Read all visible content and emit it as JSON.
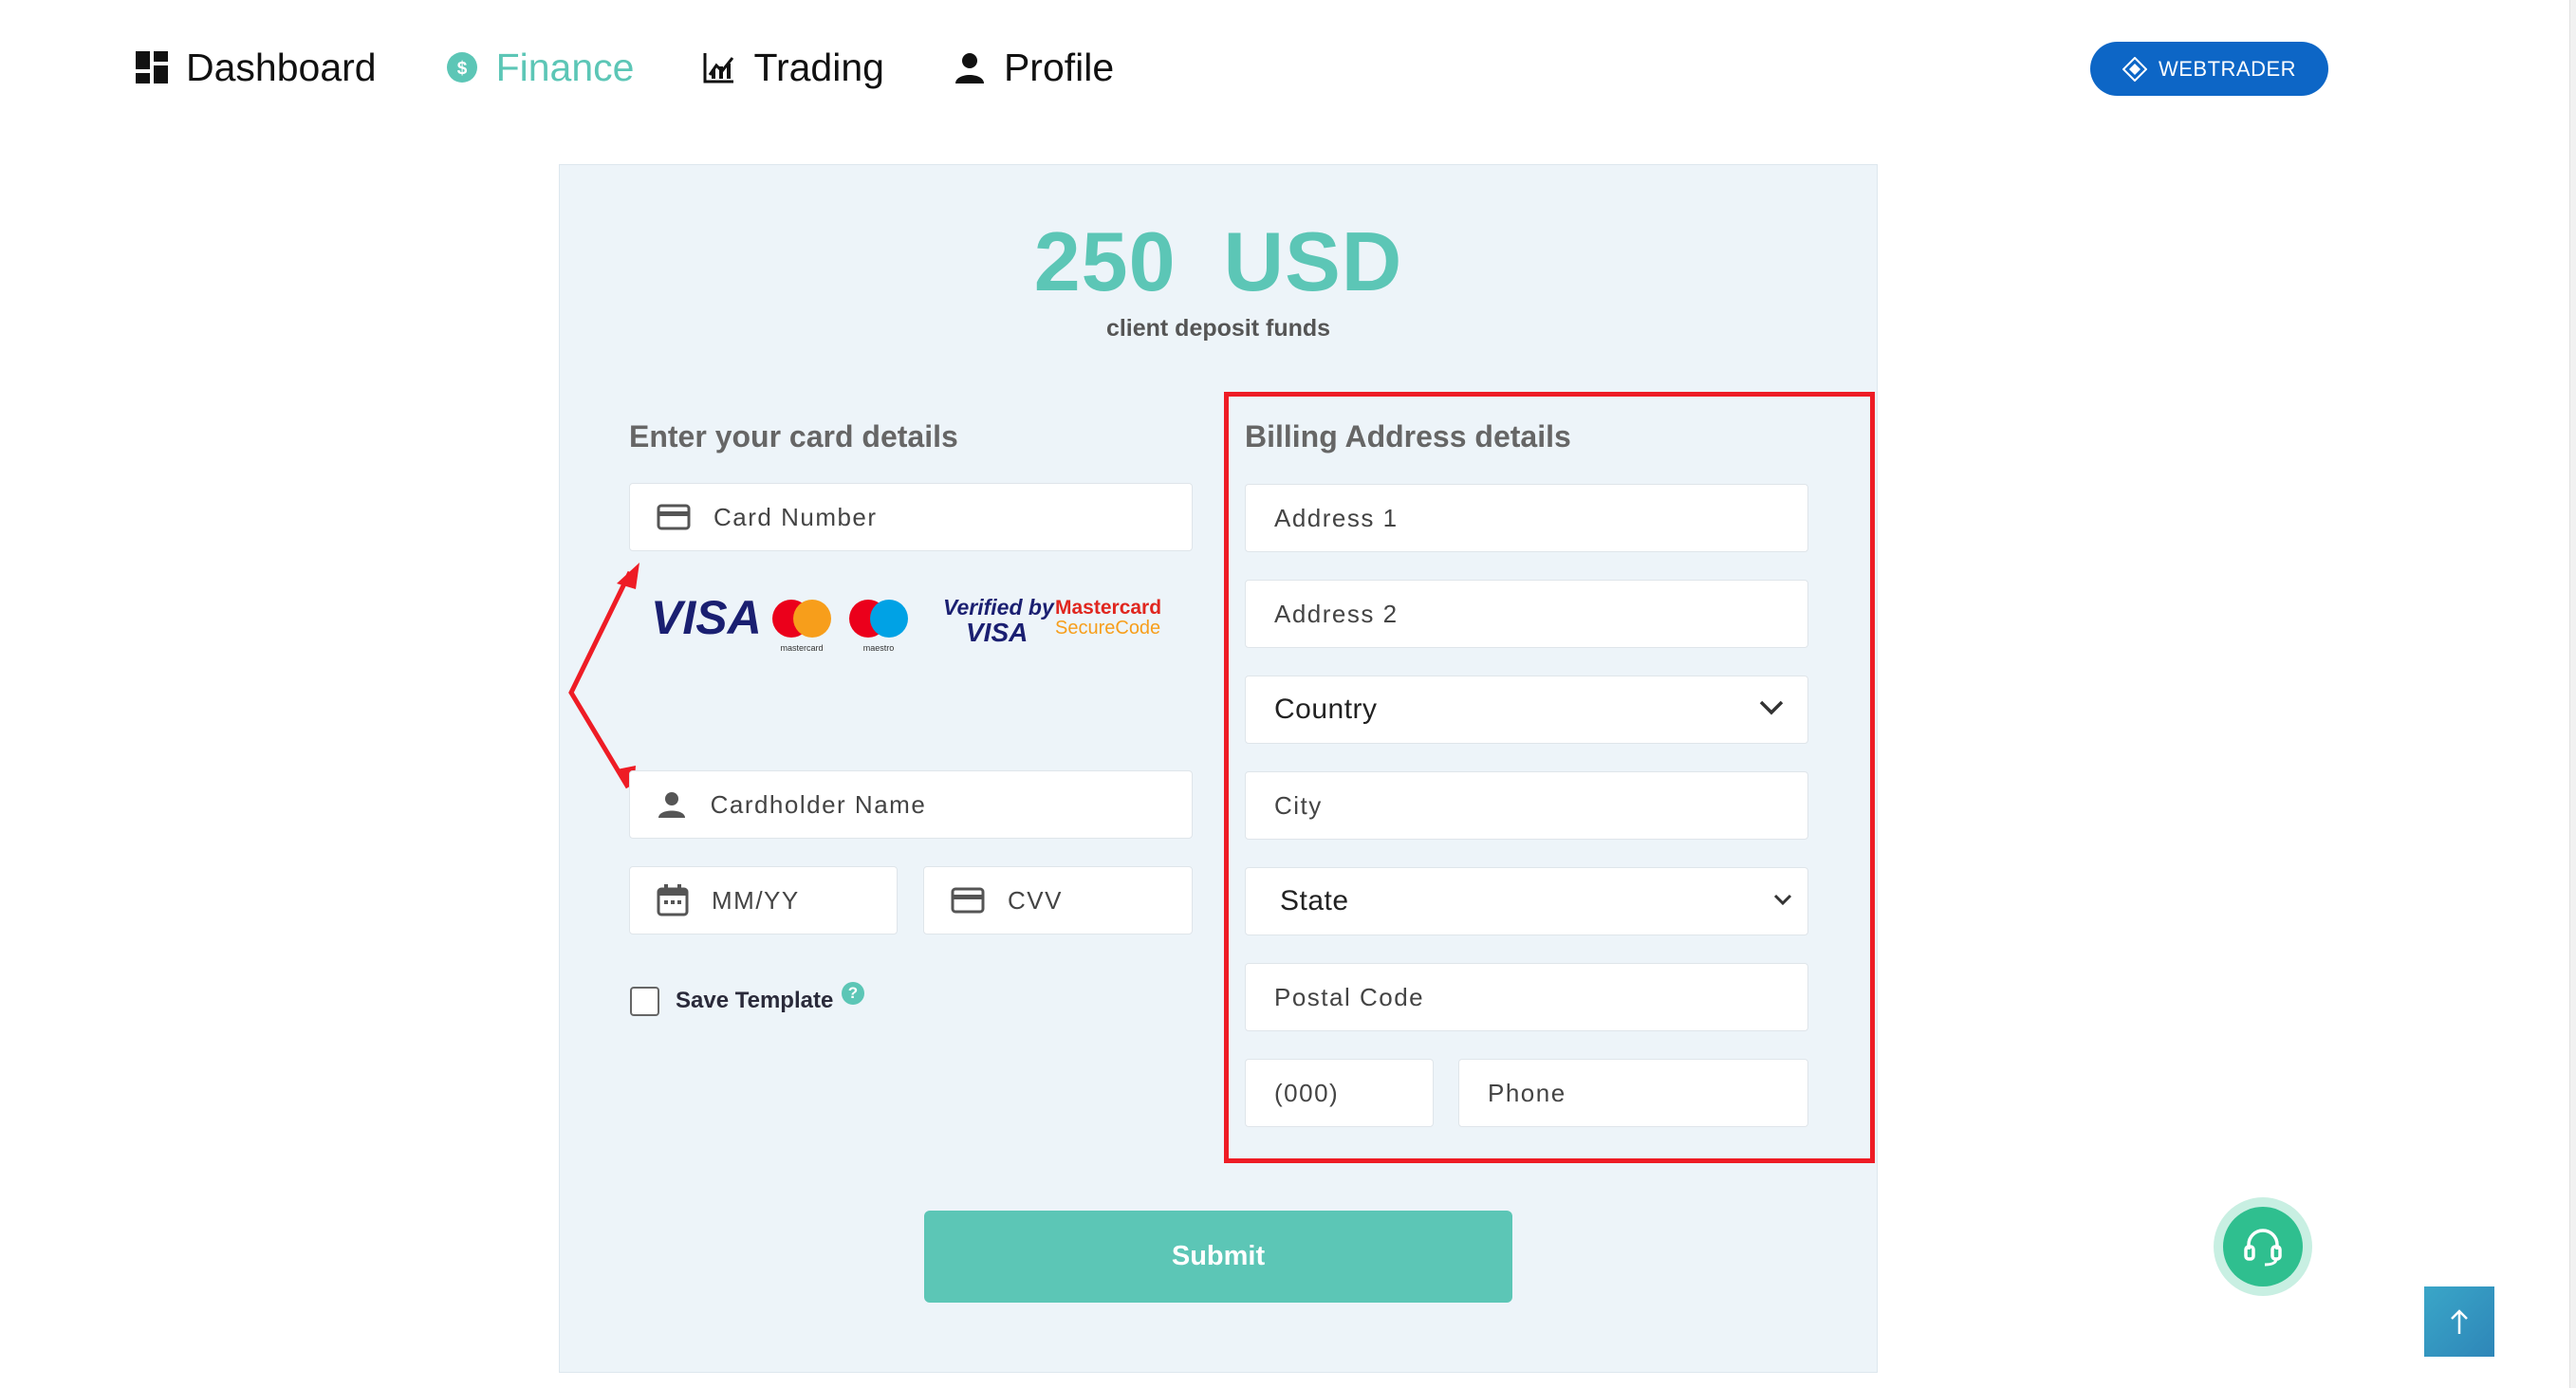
{
  "nav": {
    "items": [
      {
        "label": "Dashboard",
        "icon": "dashboard-icon"
      },
      {
        "label": "Finance",
        "icon": "dollar-coin-icon",
        "active": true
      },
      {
        "label": "Trading",
        "icon": "chart-icon"
      },
      {
        "label": "Profile",
        "icon": "person-icon"
      }
    ],
    "webtrader_label": "WEBTRADER"
  },
  "deposit": {
    "amount": "250",
    "currency": "USD",
    "caption": "client deposit funds"
  },
  "card": {
    "title": "Enter your card details",
    "card_number_placeholder": "Card Number",
    "cardholder_placeholder": "Cardholder Name",
    "expiry_placeholder": "MM/YY",
    "cvv_placeholder": "CVV",
    "logos": {
      "visa": "VISA",
      "mastercard": "mastercard",
      "maestro": "maestro",
      "verified_by": "Verified by",
      "verified_visa": "VISA",
      "mc_secure_1": "Mastercard",
      "mc_secure_2": "SecureCode"
    },
    "save_template_label": "Save Template",
    "help_glyph": "?"
  },
  "billing": {
    "title": "Billing Address details",
    "address1_placeholder": "Address 1",
    "address2_placeholder": "Address 2",
    "country_label": "Country",
    "city_placeholder": "City",
    "state_label": "State",
    "postal_placeholder": "Postal Code",
    "phone_code_placeholder": "(000)",
    "phone_placeholder": "Phone"
  },
  "submit_label": "Submit",
  "colors": {
    "accent": "#5cc6b6",
    "webtrader": "#0d66c6",
    "highlight": "#ee1c25",
    "panel": "#edf4f9"
  }
}
